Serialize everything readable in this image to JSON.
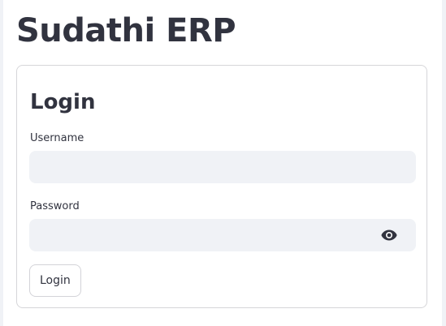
{
  "app": {
    "title": "Sudathi ERP"
  },
  "login_form": {
    "heading": "Login",
    "username": {
      "label": "Username",
      "value": "",
      "placeholder": ""
    },
    "password": {
      "label": "Password",
      "value": "",
      "placeholder": "",
      "toggle_icon": "eye-icon"
    },
    "submit_label": "Login"
  },
  "colors": {
    "text": "#31333f",
    "input_background": "#f0f2f6",
    "card_border": "#d6d6d9",
    "page_background": "#ffffff"
  }
}
